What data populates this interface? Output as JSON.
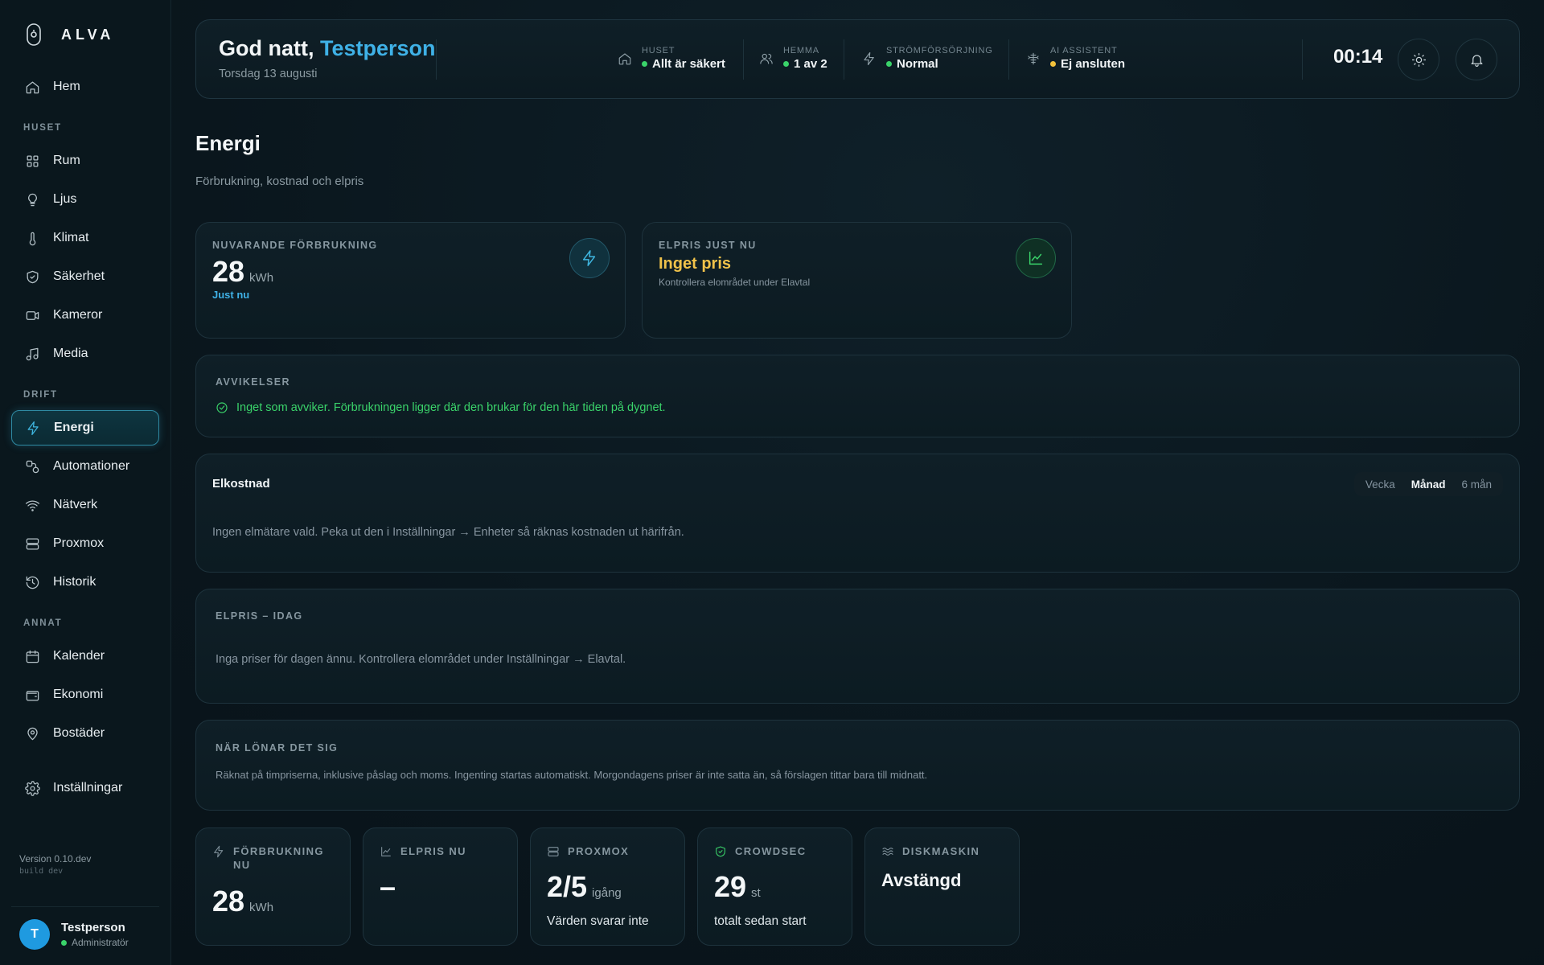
{
  "app": {
    "name": "ALVA"
  },
  "sidebar": {
    "home": "Hem",
    "sections": {
      "huset": "HUSET",
      "drift": "DRIFT",
      "annat": "ANNAT"
    },
    "huset_items": [
      "Rum",
      "Ljus",
      "Klimat",
      "Säkerhet",
      "Kameror",
      "Media"
    ],
    "drift_items": [
      "Energi",
      "Automationer",
      "Nätverk",
      "Proxmox",
      "Historik"
    ],
    "annat_items": [
      "Kalender",
      "Ekonomi",
      "Bostäder"
    ],
    "settings": "Inställningar",
    "version": "Version 0.10.dev",
    "build": "build dev",
    "user": {
      "initial": "T",
      "name": "Testperson",
      "role": "Administratör"
    }
  },
  "header": {
    "greeting": "God natt,",
    "name": "Testperson",
    "date": "Torsdag 13 augusti",
    "statuses": [
      {
        "label": "HUSET",
        "value": "Allt är säkert",
        "color": "#3ad36a",
        "icon": "home-icon"
      },
      {
        "label": "HEMMA",
        "value": "1 av 2",
        "color": "#3ad36a",
        "icon": "people-icon"
      },
      {
        "label": "STRÖMFÖRSÖRJNING",
        "value": "Normal",
        "color": "#3ad36a",
        "icon": "bolt-icon"
      },
      {
        "label": "AI ASSISTENT",
        "value": "Ej ansluten",
        "color": "#f2c13b",
        "icon": "ai-icon"
      }
    ],
    "clock": "00:14"
  },
  "page": {
    "title": "Energi",
    "subtitle": "Förbrukning, kostnad och elpris"
  },
  "consumption_card": {
    "caption": "NUVARANDE FÖRBRUKNING",
    "value": "28",
    "unit": "kWh",
    "note": "Just nu"
  },
  "price_card": {
    "caption": "ELPRIS JUST NU",
    "value": "Inget pris",
    "note": "Kontrollera elområdet under Elavtal"
  },
  "deviations": {
    "caption": "AVVIKELSER",
    "message": "Inget som avviker. Förbrukningen ligger där den brukar för den här tiden på dygnet."
  },
  "cost": {
    "title": "Elkostnad",
    "tabs": [
      "Vecka",
      "Månad",
      "6 mån"
    ],
    "active_tab": "Månad",
    "message": "Ingen elmätare vald. Peka ut den i Inställningar → Enheter så räknas kostnaden ut härifrån."
  },
  "price_today": {
    "caption": "ELPRIS – IDAG",
    "message": "Inga priser för dagen ännu. Kontrollera elområdet under Inställningar → Elavtal."
  },
  "worth_it": {
    "caption": "NÄR LÖNAR DET SIG",
    "message": "Räknat på timpriserna, inklusive påslag och moms. Ingenting startas automatiskt. Morgondagens priser är inte satta än, så förslagen tittar bara till midnatt."
  },
  "tiles": [
    {
      "caption": "FÖRBRUKNING NU",
      "value": "28",
      "unit": "kWh",
      "footer": ""
    },
    {
      "caption": "ELPRIS NU",
      "value": "–",
      "unit": "",
      "footer": ""
    },
    {
      "caption": "PROXMOX",
      "value": "2/5",
      "unit": "igång",
      "footer": "Värden svarar inte"
    },
    {
      "caption": "CROWDSEC",
      "value": "29",
      "unit": "st",
      "footer": "totalt sedan start"
    },
    {
      "caption": "DISKMASKIN",
      "value": "Avstängd",
      "unit": "",
      "footer": ""
    }
  ],
  "colors": {
    "accent": "#3fb1e6",
    "ok": "#3ad36a",
    "warn": "#f2c13b",
    "price": "#f0c24a"
  }
}
